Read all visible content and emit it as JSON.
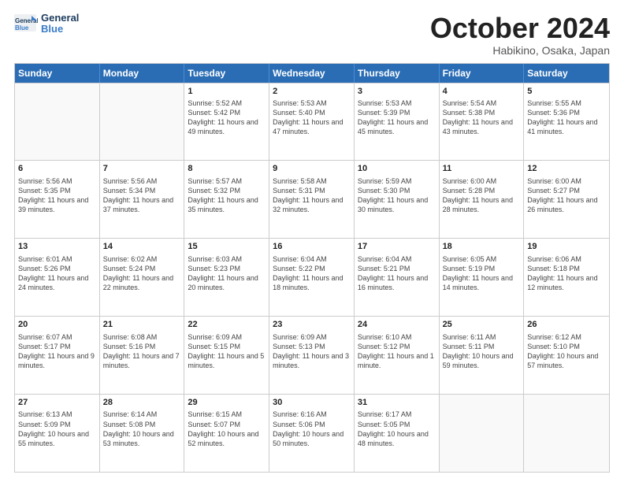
{
  "logo": {
    "line1": "General",
    "line2": "Blue"
  },
  "title": "October 2024",
  "location": "Habikino, Osaka, Japan",
  "header_days": [
    "Sunday",
    "Monday",
    "Tuesday",
    "Wednesday",
    "Thursday",
    "Friday",
    "Saturday"
  ],
  "weeks": [
    [
      {
        "day": "",
        "info": ""
      },
      {
        "day": "",
        "info": ""
      },
      {
        "day": "1",
        "info": "Sunrise: 5:52 AM\nSunset: 5:42 PM\nDaylight: 11 hours and 49 minutes."
      },
      {
        "day": "2",
        "info": "Sunrise: 5:53 AM\nSunset: 5:40 PM\nDaylight: 11 hours and 47 minutes."
      },
      {
        "day": "3",
        "info": "Sunrise: 5:53 AM\nSunset: 5:39 PM\nDaylight: 11 hours and 45 minutes."
      },
      {
        "day": "4",
        "info": "Sunrise: 5:54 AM\nSunset: 5:38 PM\nDaylight: 11 hours and 43 minutes."
      },
      {
        "day": "5",
        "info": "Sunrise: 5:55 AM\nSunset: 5:36 PM\nDaylight: 11 hours and 41 minutes."
      }
    ],
    [
      {
        "day": "6",
        "info": "Sunrise: 5:56 AM\nSunset: 5:35 PM\nDaylight: 11 hours and 39 minutes."
      },
      {
        "day": "7",
        "info": "Sunrise: 5:56 AM\nSunset: 5:34 PM\nDaylight: 11 hours and 37 minutes."
      },
      {
        "day": "8",
        "info": "Sunrise: 5:57 AM\nSunset: 5:32 PM\nDaylight: 11 hours and 35 minutes."
      },
      {
        "day": "9",
        "info": "Sunrise: 5:58 AM\nSunset: 5:31 PM\nDaylight: 11 hours and 32 minutes."
      },
      {
        "day": "10",
        "info": "Sunrise: 5:59 AM\nSunset: 5:30 PM\nDaylight: 11 hours and 30 minutes."
      },
      {
        "day": "11",
        "info": "Sunrise: 6:00 AM\nSunset: 5:28 PM\nDaylight: 11 hours and 28 minutes."
      },
      {
        "day": "12",
        "info": "Sunrise: 6:00 AM\nSunset: 5:27 PM\nDaylight: 11 hours and 26 minutes."
      }
    ],
    [
      {
        "day": "13",
        "info": "Sunrise: 6:01 AM\nSunset: 5:26 PM\nDaylight: 11 hours and 24 minutes."
      },
      {
        "day": "14",
        "info": "Sunrise: 6:02 AM\nSunset: 5:24 PM\nDaylight: 11 hours and 22 minutes."
      },
      {
        "day": "15",
        "info": "Sunrise: 6:03 AM\nSunset: 5:23 PM\nDaylight: 11 hours and 20 minutes."
      },
      {
        "day": "16",
        "info": "Sunrise: 6:04 AM\nSunset: 5:22 PM\nDaylight: 11 hours and 18 minutes."
      },
      {
        "day": "17",
        "info": "Sunrise: 6:04 AM\nSunset: 5:21 PM\nDaylight: 11 hours and 16 minutes."
      },
      {
        "day": "18",
        "info": "Sunrise: 6:05 AM\nSunset: 5:19 PM\nDaylight: 11 hours and 14 minutes."
      },
      {
        "day": "19",
        "info": "Sunrise: 6:06 AM\nSunset: 5:18 PM\nDaylight: 11 hours and 12 minutes."
      }
    ],
    [
      {
        "day": "20",
        "info": "Sunrise: 6:07 AM\nSunset: 5:17 PM\nDaylight: 11 hours and 9 minutes."
      },
      {
        "day": "21",
        "info": "Sunrise: 6:08 AM\nSunset: 5:16 PM\nDaylight: 11 hours and 7 minutes."
      },
      {
        "day": "22",
        "info": "Sunrise: 6:09 AM\nSunset: 5:15 PM\nDaylight: 11 hours and 5 minutes."
      },
      {
        "day": "23",
        "info": "Sunrise: 6:09 AM\nSunset: 5:13 PM\nDaylight: 11 hours and 3 minutes."
      },
      {
        "day": "24",
        "info": "Sunrise: 6:10 AM\nSunset: 5:12 PM\nDaylight: 11 hours and 1 minute."
      },
      {
        "day": "25",
        "info": "Sunrise: 6:11 AM\nSunset: 5:11 PM\nDaylight: 10 hours and 59 minutes."
      },
      {
        "day": "26",
        "info": "Sunrise: 6:12 AM\nSunset: 5:10 PM\nDaylight: 10 hours and 57 minutes."
      }
    ],
    [
      {
        "day": "27",
        "info": "Sunrise: 6:13 AM\nSunset: 5:09 PM\nDaylight: 10 hours and 55 minutes."
      },
      {
        "day": "28",
        "info": "Sunrise: 6:14 AM\nSunset: 5:08 PM\nDaylight: 10 hours and 53 minutes."
      },
      {
        "day": "29",
        "info": "Sunrise: 6:15 AM\nSunset: 5:07 PM\nDaylight: 10 hours and 52 minutes."
      },
      {
        "day": "30",
        "info": "Sunrise: 6:16 AM\nSunset: 5:06 PM\nDaylight: 10 hours and 50 minutes."
      },
      {
        "day": "31",
        "info": "Sunrise: 6:17 AM\nSunset: 5:05 PM\nDaylight: 10 hours and 48 minutes."
      },
      {
        "day": "",
        "info": ""
      },
      {
        "day": "",
        "info": ""
      }
    ]
  ]
}
